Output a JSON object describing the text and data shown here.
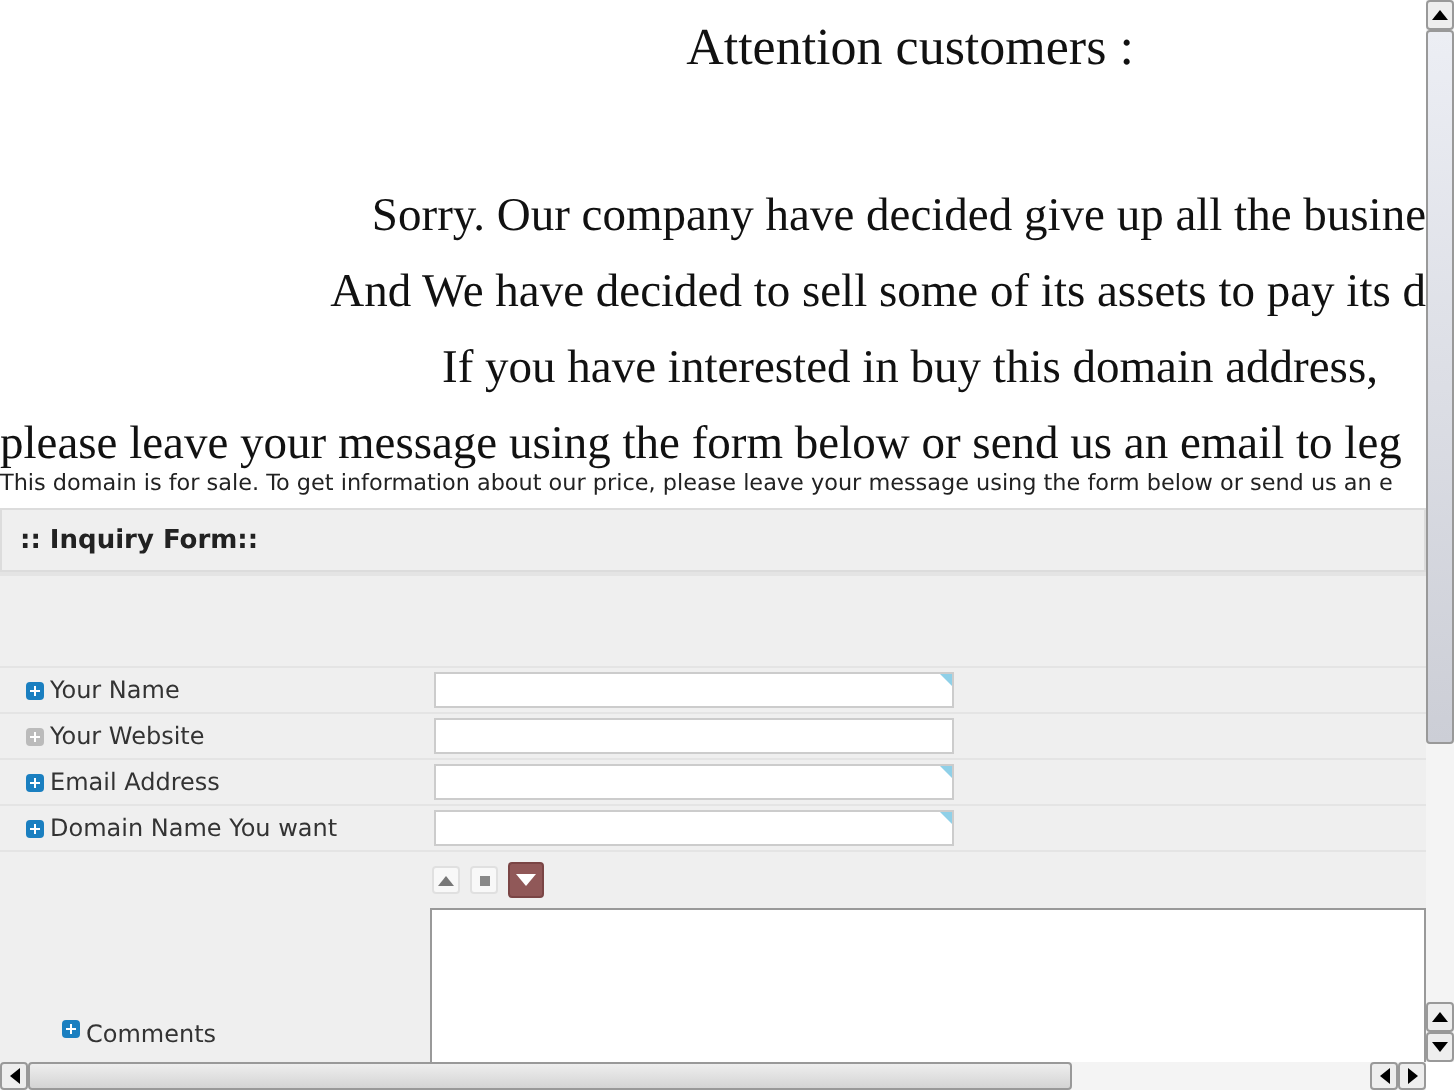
{
  "notice": {
    "title": "Attention customers :",
    "lines": [
      "Sorry. Our company have decided give up all the busine",
      "And We have decided to sell some of its assets to pay its d",
      "If you have interested in buy this domain address,",
      "please leave your message using the form below or send us an email to leg"
    ]
  },
  "sale_text": "This domain is for sale. To get information about our price, please leave your message using the form below or send us an e",
  "form": {
    "title": ":: Inquiry Form::",
    "fields": [
      {
        "label": "Your Name",
        "required": true
      },
      {
        "label": "Your Website",
        "required": false
      },
      {
        "label": "Email Address",
        "required": true
      },
      {
        "label": "Domain Name You want",
        "required": true
      }
    ],
    "comments": {
      "label": "Comments",
      "required": true
    }
  }
}
